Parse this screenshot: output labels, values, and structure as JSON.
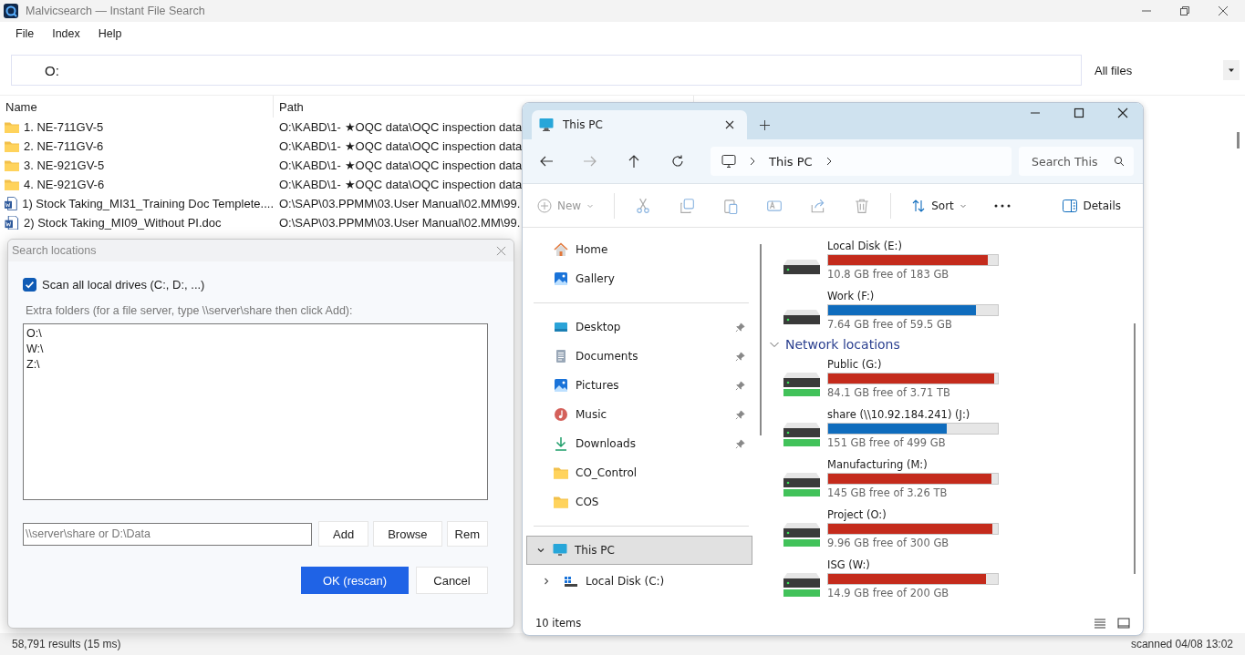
{
  "window": {
    "title": "Malvicsearch — Instant File Search"
  },
  "menu": [
    "File",
    "Index",
    "Help"
  ],
  "search": {
    "value": "O:"
  },
  "filter": {
    "value": "All files"
  },
  "table": {
    "columns": [
      "Name",
      "Path"
    ],
    "rows": [
      {
        "kind": "folder",
        "name": "1. NE-711GV-5",
        "path": "O:\\KABD\\1- ★OQC data\\OQC inspection data"
      },
      {
        "kind": "folder",
        "name": "2. NE-711GV-6",
        "path": "O:\\KABD\\1- ★OQC data\\OQC inspection data"
      },
      {
        "kind": "folder",
        "name": "3. NE-921GV-5",
        "path": "O:\\KABD\\1- ★OQC data\\OQC inspection data"
      },
      {
        "kind": "folder",
        "name": "4. NE-921GV-6",
        "path": "O:\\KABD\\1- ★OQC data\\OQC inspection data"
      },
      {
        "kind": "doc",
        "name": "1) Stock Taking_MI31_Training Doc Templete....",
        "path": "O:\\SAP\\03.PPMM\\03.User Manual\\02.MM\\99."
      },
      {
        "kind": "doc",
        "name": "2) Stock Taking_MI09_Without PI.doc",
        "path": "O:\\SAP\\03.PPMM\\03.User Manual\\02.MM\\99."
      }
    ]
  },
  "status_bar": {
    "results": "58,791 results (15 ms)",
    "index": "scanned 04/08 13:02"
  },
  "dialog": {
    "title": "Search locations",
    "scan_all": {
      "label": "Scan all local drives (C:, D:, ...)",
      "checked": true
    },
    "folders_label": "Extra folders (for a file server, type \\\\server\\share then click Add):",
    "folders": [
      "O:\\",
      "W:\\",
      "Z:\\"
    ],
    "path_input": {
      "placeholder": "\\\\server\\share or D:\\Data"
    },
    "buttons": [
      "Add",
      "Browse",
      "Rem"
    ],
    "ok": "OK (rescan)",
    "cancel": "Cancel"
  },
  "explorer": {
    "tabs": [
      {
        "label": "This PC",
        "selected": true
      }
    ],
    "address": [
      "This PC"
    ],
    "search": {
      "placeholder": "Search This"
    },
    "commands": {
      "new": "New",
      "sort": "Sort",
      "details": "Details"
    },
    "sidebar": {
      "quick": [
        {
          "kind": "home",
          "label": "Home",
          "pinned": false
        },
        {
          "kind": "gallery",
          "label": "Gallery",
          "pinned": false
        }
      ],
      "places": [
        {
          "kind": "desktop",
          "label": "Desktop",
          "pinned": true
        },
        {
          "kind": "documents",
          "label": "Documents",
          "pinned": true
        },
        {
          "kind": "pictures",
          "label": "Pictures",
          "pinned": true
        },
        {
          "kind": "music",
          "label": "Music",
          "pinned": true
        },
        {
          "kind": "downloads",
          "label": "Downloads",
          "pinned": true
        },
        {
          "kind": "folder",
          "label": "CO_Control",
          "pinned": false
        },
        {
          "kind": "folder",
          "label": "COS",
          "pinned": false
        }
      ],
      "tree": [
        {
          "label": "This PC",
          "selected": true,
          "expanded": true,
          "children": [
            {
              "label": "Local Disk (C:)",
              "selected": false,
              "expanded": false
            }
          ]
        }
      ]
    },
    "drives": [
      {
        "kind": "local",
        "name": "Local Disk (E:)",
        "level": 0.94,
        "color": "#c42b1c",
        "free": "10.8 GB free of 183 GB"
      },
      {
        "kind": "local",
        "name": "Work (F:)",
        "level": 0.87,
        "color": "#0f6cbd",
        "free": "7.64 GB free of 59.5 GB"
      }
    ],
    "network": {
      "label": "Network locations",
      "expanded": true,
      "drives": [
        {
          "kind": "network",
          "name": "Public (G:)",
          "level": 0.98,
          "color": "#c42b1c",
          "free": "84.1 GB free of 3.71 TB"
        },
        {
          "kind": "network",
          "name": "share (\\\\10.92.184.241) (J:)",
          "level": 0.7,
          "color": "#0f6cbd",
          "free": "151 GB free of 499 GB"
        },
        {
          "kind": "network",
          "name": "Manufacturing (M:)",
          "level": 0.96,
          "color": "#c42b1c",
          "free": "145 GB free of 3.26 TB"
        },
        {
          "kind": "network",
          "name": "Project (O:)",
          "level": 0.97,
          "color": "#c42b1c",
          "free": "9.96 GB free of 300 GB"
        },
        {
          "kind": "network",
          "name": "ISG (W:)",
          "level": 0.93,
          "color": "#c42b1c",
          "free": "14.9 GB free of 200 GB"
        }
      ]
    },
    "status": "10 items"
  }
}
